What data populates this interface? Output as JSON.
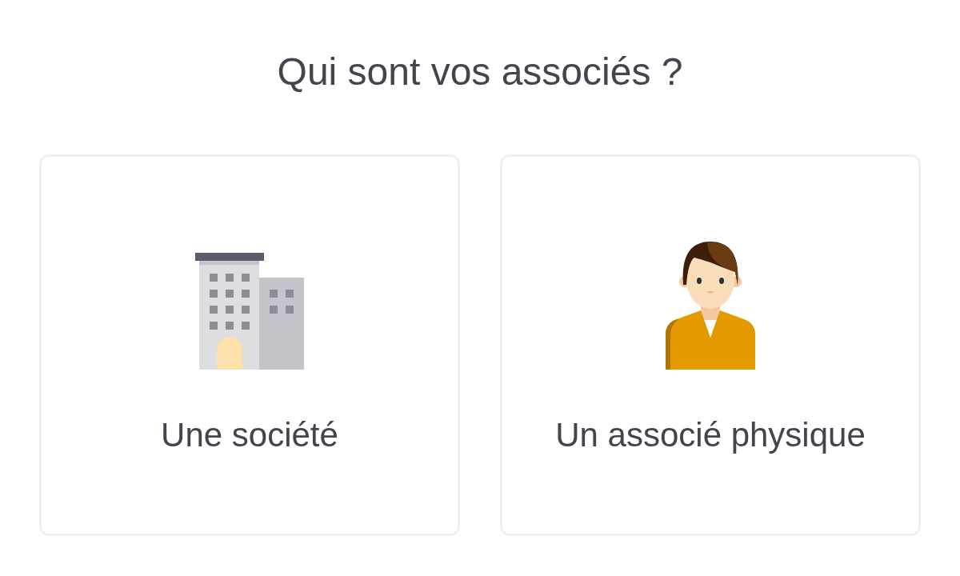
{
  "title": "Qui sont vos associés ?",
  "options": [
    {
      "kind": "company",
      "label": "Une société",
      "selected": false
    },
    {
      "kind": "person",
      "label": "Un associé physique",
      "selected": false
    }
  ]
}
